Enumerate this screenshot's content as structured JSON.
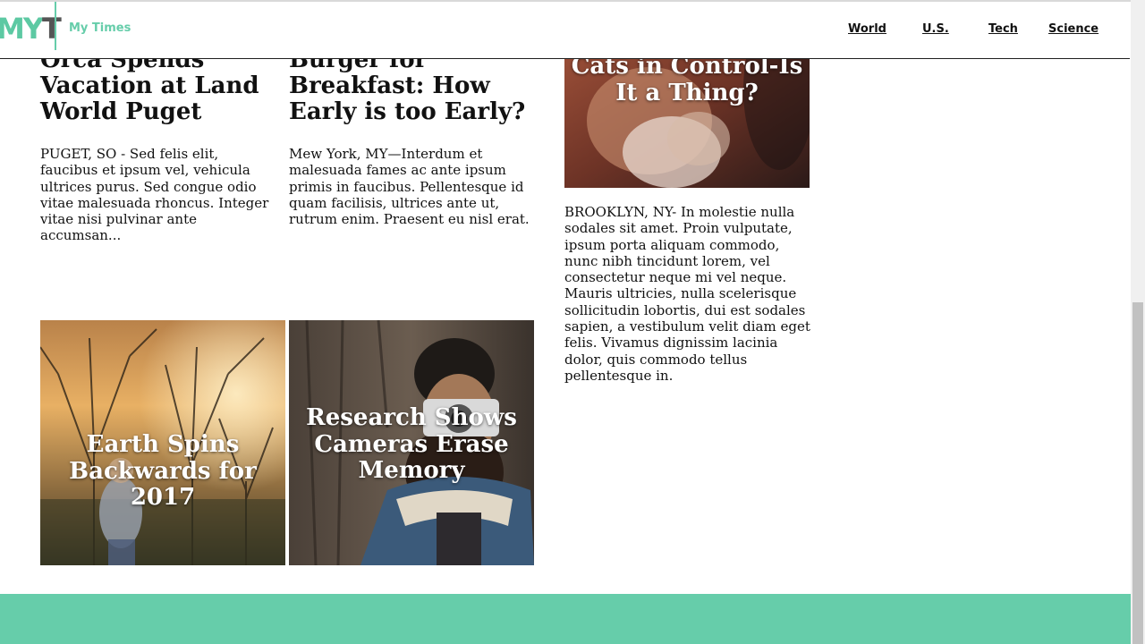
{
  "header": {
    "logo_part1": "MY",
    "logo_part2": "T",
    "brand": "My Times",
    "nav": [
      "World",
      "U.S.",
      "Tech",
      "Science"
    ]
  },
  "articles": [
    {
      "title": "Orca Spends Vacation at Land World Puget",
      "body": "PUGET, SO - Sed felis elit, faucibus et ipsum vel, vehicula ultrices purus. Sed congue odio vitae malesuada rhoncus. Integer vitae nisi pulvinar ante accumsan..."
    },
    {
      "title": "Burger for Breakfast: How Early is too Early?",
      "body": "Mew York, MY—Interdum et malesuada fames ac ante ipsum primis in faucibus. Pellentesque id quam facilisis, ultrices ante ut, rutrum enim. Praesent eu nisl erat."
    },
    {
      "title": "Cats in Control-Is It a Thing?",
      "body": "BROOKLYN, NY- In molestie nulla sodales sit amet. Proin vulputate, ipsum porta aliquam commodo, nunc nibh tincidunt lorem, vel consectetur neque mi vel neque. Mauris ultricies, nulla scelerisque sollicitudin lobortis, dui est sodales sapien, a vestibulum velit diam eget felis. Vivamus dignissim lacinia dolor, quis commodo tellus pellentesque in."
    }
  ],
  "tiles": [
    {
      "title": "Earth Spins Backwards for 2017"
    },
    {
      "title": "Research Shows Cameras Erase Memory"
    }
  ],
  "colors": {
    "accent": "#66cdaa",
    "text": "#111111"
  }
}
